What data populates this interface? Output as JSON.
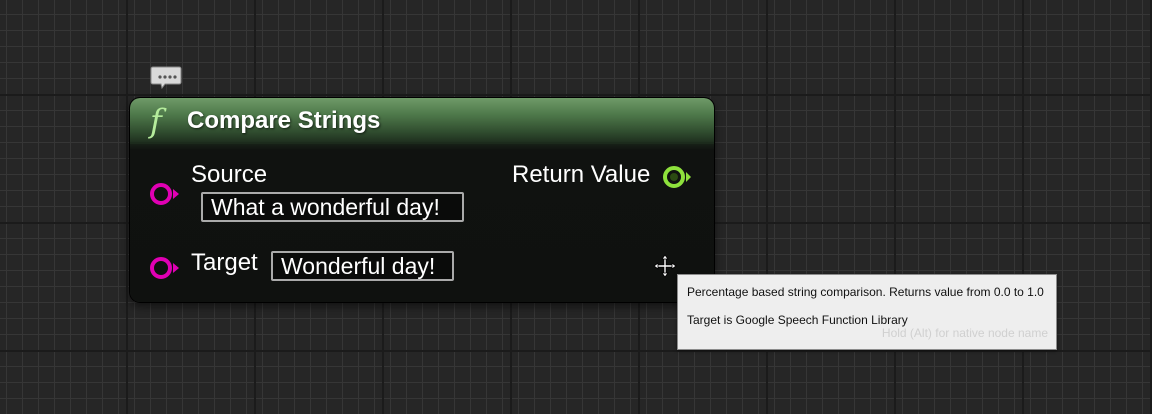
{
  "node": {
    "title": "Compare Strings",
    "function_icon": "f",
    "header_color": "#4f7a4b",
    "inputs": [
      {
        "label": "Source",
        "value": "What a wonderful day!"
      },
      {
        "label": "Target",
        "value": "Wonderful day!"
      }
    ],
    "output": {
      "label": "Return Value"
    }
  },
  "pin_colors": {
    "string": "#e100b4",
    "float": "#8ee13c"
  },
  "tooltip": {
    "description": "Percentage based string comparison. Returns value from 0.0 to 1.0",
    "target": "Target is Google Speech Function Library",
    "hint": "Hold (Alt) for native node name"
  },
  "icons": {
    "comment": "comment-bubble-icon",
    "cursor": "move-cursor-icon"
  }
}
